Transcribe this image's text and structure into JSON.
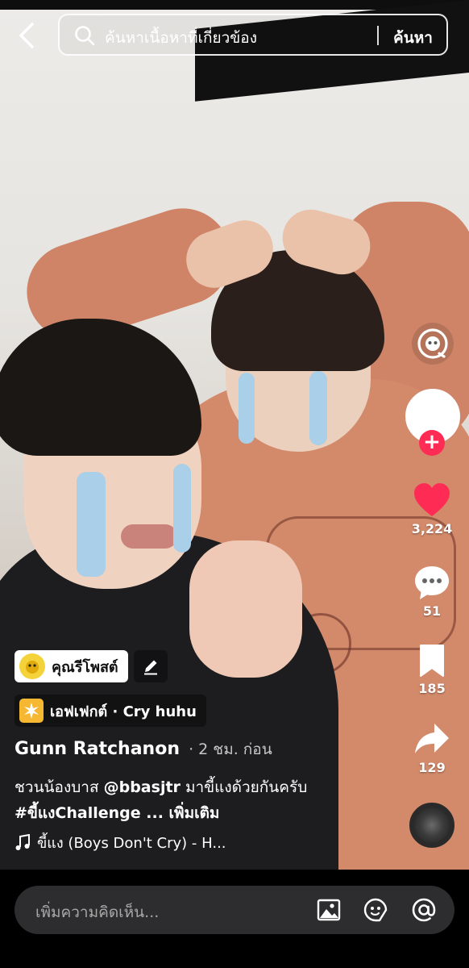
{
  "search": {
    "placeholder": "ค้นหาเนื้อหาที่เกี่ยวข้อง",
    "submit_label": "ค้นหา"
  },
  "rail": {
    "likes": "3,224",
    "comments": "51",
    "saves": "185",
    "shares": "129"
  },
  "poster_tag": {
    "label": "คุณรีโพสต์"
  },
  "effect_tag": {
    "label": "เอฟเฟกต์ · Cry huhu"
  },
  "video": {
    "author": "Gunn Ratchanon",
    "time": "· 2 ชม. ก่อน",
    "caption_part1": "ชวนน้องบาส ",
    "caption_mention": "@bbasjtr",
    "caption_part2": " มาขี้แงด้วยกันครับ",
    "caption_hashtag": "#ขี้แงChallenge",
    "caption_ellipsis": " ... ",
    "caption_more": "เพิ่มเติม",
    "music": "ขี้แง (Boys Don't Cry) - H..."
  },
  "comment_bar": {
    "placeholder": "เพิ่มความคิดเห็น..."
  },
  "colors": {
    "like": "#fe2c55",
    "background": "#000000"
  }
}
